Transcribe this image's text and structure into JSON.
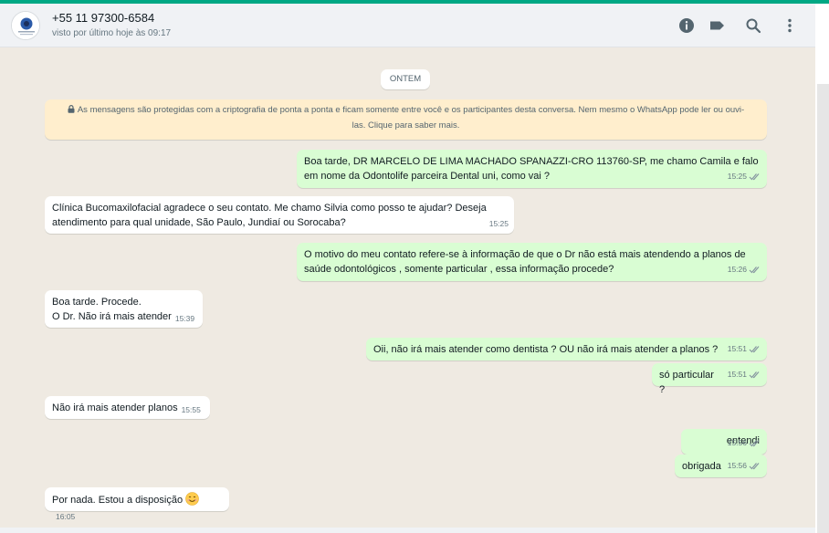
{
  "header": {
    "contact_name": "+55 11 97300-6584",
    "last_seen": "visto por último hoje às 09:17",
    "icons": [
      "info-icon",
      "label-icon",
      "search-icon",
      "menu-icon"
    ]
  },
  "chat": {
    "date_chip": "ONTEM",
    "encryption_notice": "As mensagens são protegidas com a criptografia de ponta a ponta e ficam somente entre você e os participantes desta conversa. Nem mesmo o WhatsApp pode ler ou ouvi-las. Clique para saber mais.",
    "messages": [
      {
        "direction": "out",
        "text": "Boa tarde, DR  MARCELO DE LIMA MACHADO SPANAZZI-CRO 113760-SP, me chamo Camila e falo em nome da Odontolife parceira Dental uni, como vai ?",
        "time": "15:25",
        "status": "read"
      },
      {
        "direction": "in",
        "text": "Clínica Bucomaxilofacial agradece o seu contato. Me chamo Silvia como posso te ajudar? Deseja atendimento para qual unidade, São Paulo, Jundiaí ou Sorocaba?",
        "time": "15:25"
      },
      {
        "direction": "out",
        "text": "O motivo do meu contato refere-se à informação de que o Dr não está mais atendendo a planos de saúde odontológicos , somente particular , essa informação procede?",
        "time": "15:26",
        "status": "read"
      },
      {
        "direction": "in",
        "line1": "Boa tarde. Procede.",
        "line2": "O Dr. Não irá mais atender",
        "time": "15:39"
      },
      {
        "direction": "out",
        "text": "Oii, não irá mais atender como dentista ? OU não irá mais atender a planos ?",
        "time": "15:51",
        "status": "read"
      },
      {
        "direction": "out",
        "text": "só particular ?",
        "time": "15:51",
        "status": "read"
      },
      {
        "direction": "in",
        "text": "Não irá mais atender planos",
        "time": "15:55"
      },
      {
        "direction": "out",
        "text": "entendi",
        "time": "15:56",
        "status": "read"
      },
      {
        "direction": "out",
        "text": "obrigada",
        "time": "15:56",
        "status": "read"
      },
      {
        "direction": "in",
        "text": "Por nada. Estou a disposição",
        "emoji": "smiling-face-emoji",
        "time": "16:05"
      }
    ]
  },
  "colors": {
    "accent": "#00a884",
    "outgoing_bubble": "#d9fdd3",
    "incoming_bubble": "#ffffff",
    "chat_background": "#efeae2",
    "read_tick": "#8696a0"
  }
}
